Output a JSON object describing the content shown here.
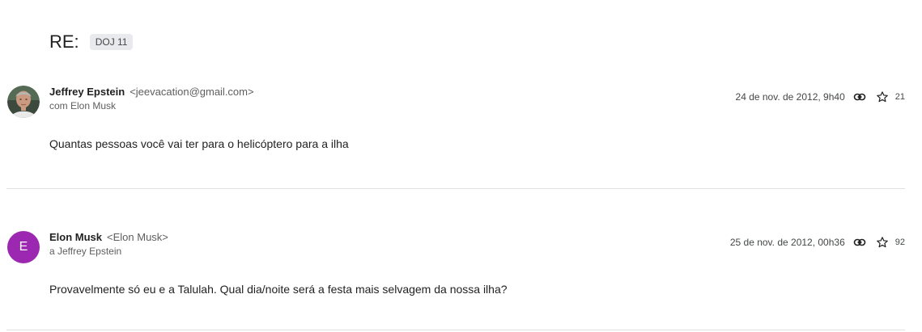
{
  "thread": {
    "subject": "RE:",
    "label": "DOJ 11"
  },
  "messages": [
    {
      "sender_name": "Jeffrey Epstein",
      "sender_email": "<jeevacation@gmail.com>",
      "recipients": "com Elon Musk",
      "date": "24 de nov. de 2012, 9h40",
      "count": "21",
      "body": "Quantas pessoas você vai ter para o helicóptero para a ilha",
      "avatar_type": "photo"
    },
    {
      "sender_name": "Elon Musk",
      "sender_email": "<Elon Musk>",
      "recipients": "a Jeffrey Epstein",
      "date": "25 de nov. de 2012, 00h36",
      "count": "92",
      "body": "Provavelmente só eu e a Talulah. Qual dia/noite será a festa mais selvagem da nossa ilha?",
      "avatar_letter": "E",
      "avatar_color": "#9c27b0"
    }
  ],
  "icons": {
    "link": "link-icon",
    "star": "star-icon"
  }
}
